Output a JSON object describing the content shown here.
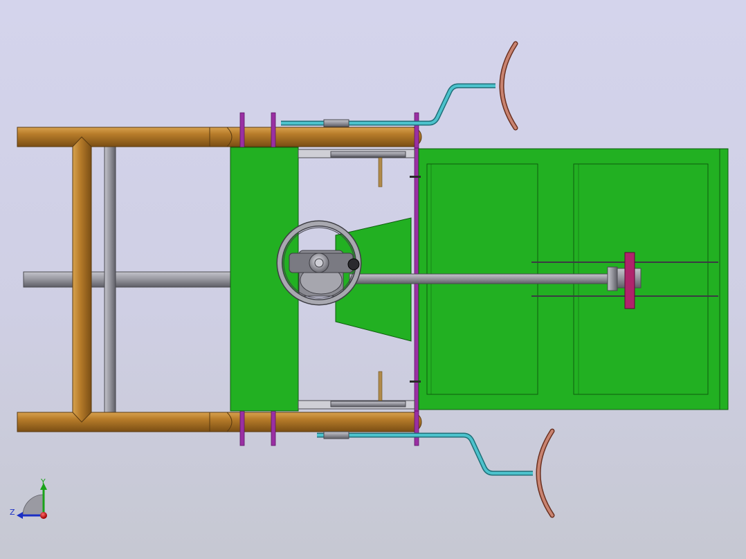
{
  "viewport": {
    "background_top": "#d4d4ec",
    "background_bottom": "#c6c8d2"
  },
  "colors": {
    "frame_tube": "#b77c2a",
    "frame_tube_dark": "#7a4e14",
    "panel_green": "#22b022",
    "panel_green_dark": "#138813",
    "steel_grey": "#9a9aa2",
    "steel_dark": "#5e5e66",
    "cyan_pipe": "#3aa8b4",
    "clamp_purple": "#9a2fa3",
    "copper_arc": "#b36a55",
    "axis_x": "#d01818",
    "axis_y": "#19a319",
    "axis_z": "#1b2fc4"
  },
  "triad": {
    "y_label": "Y",
    "z_label": "Z"
  }
}
